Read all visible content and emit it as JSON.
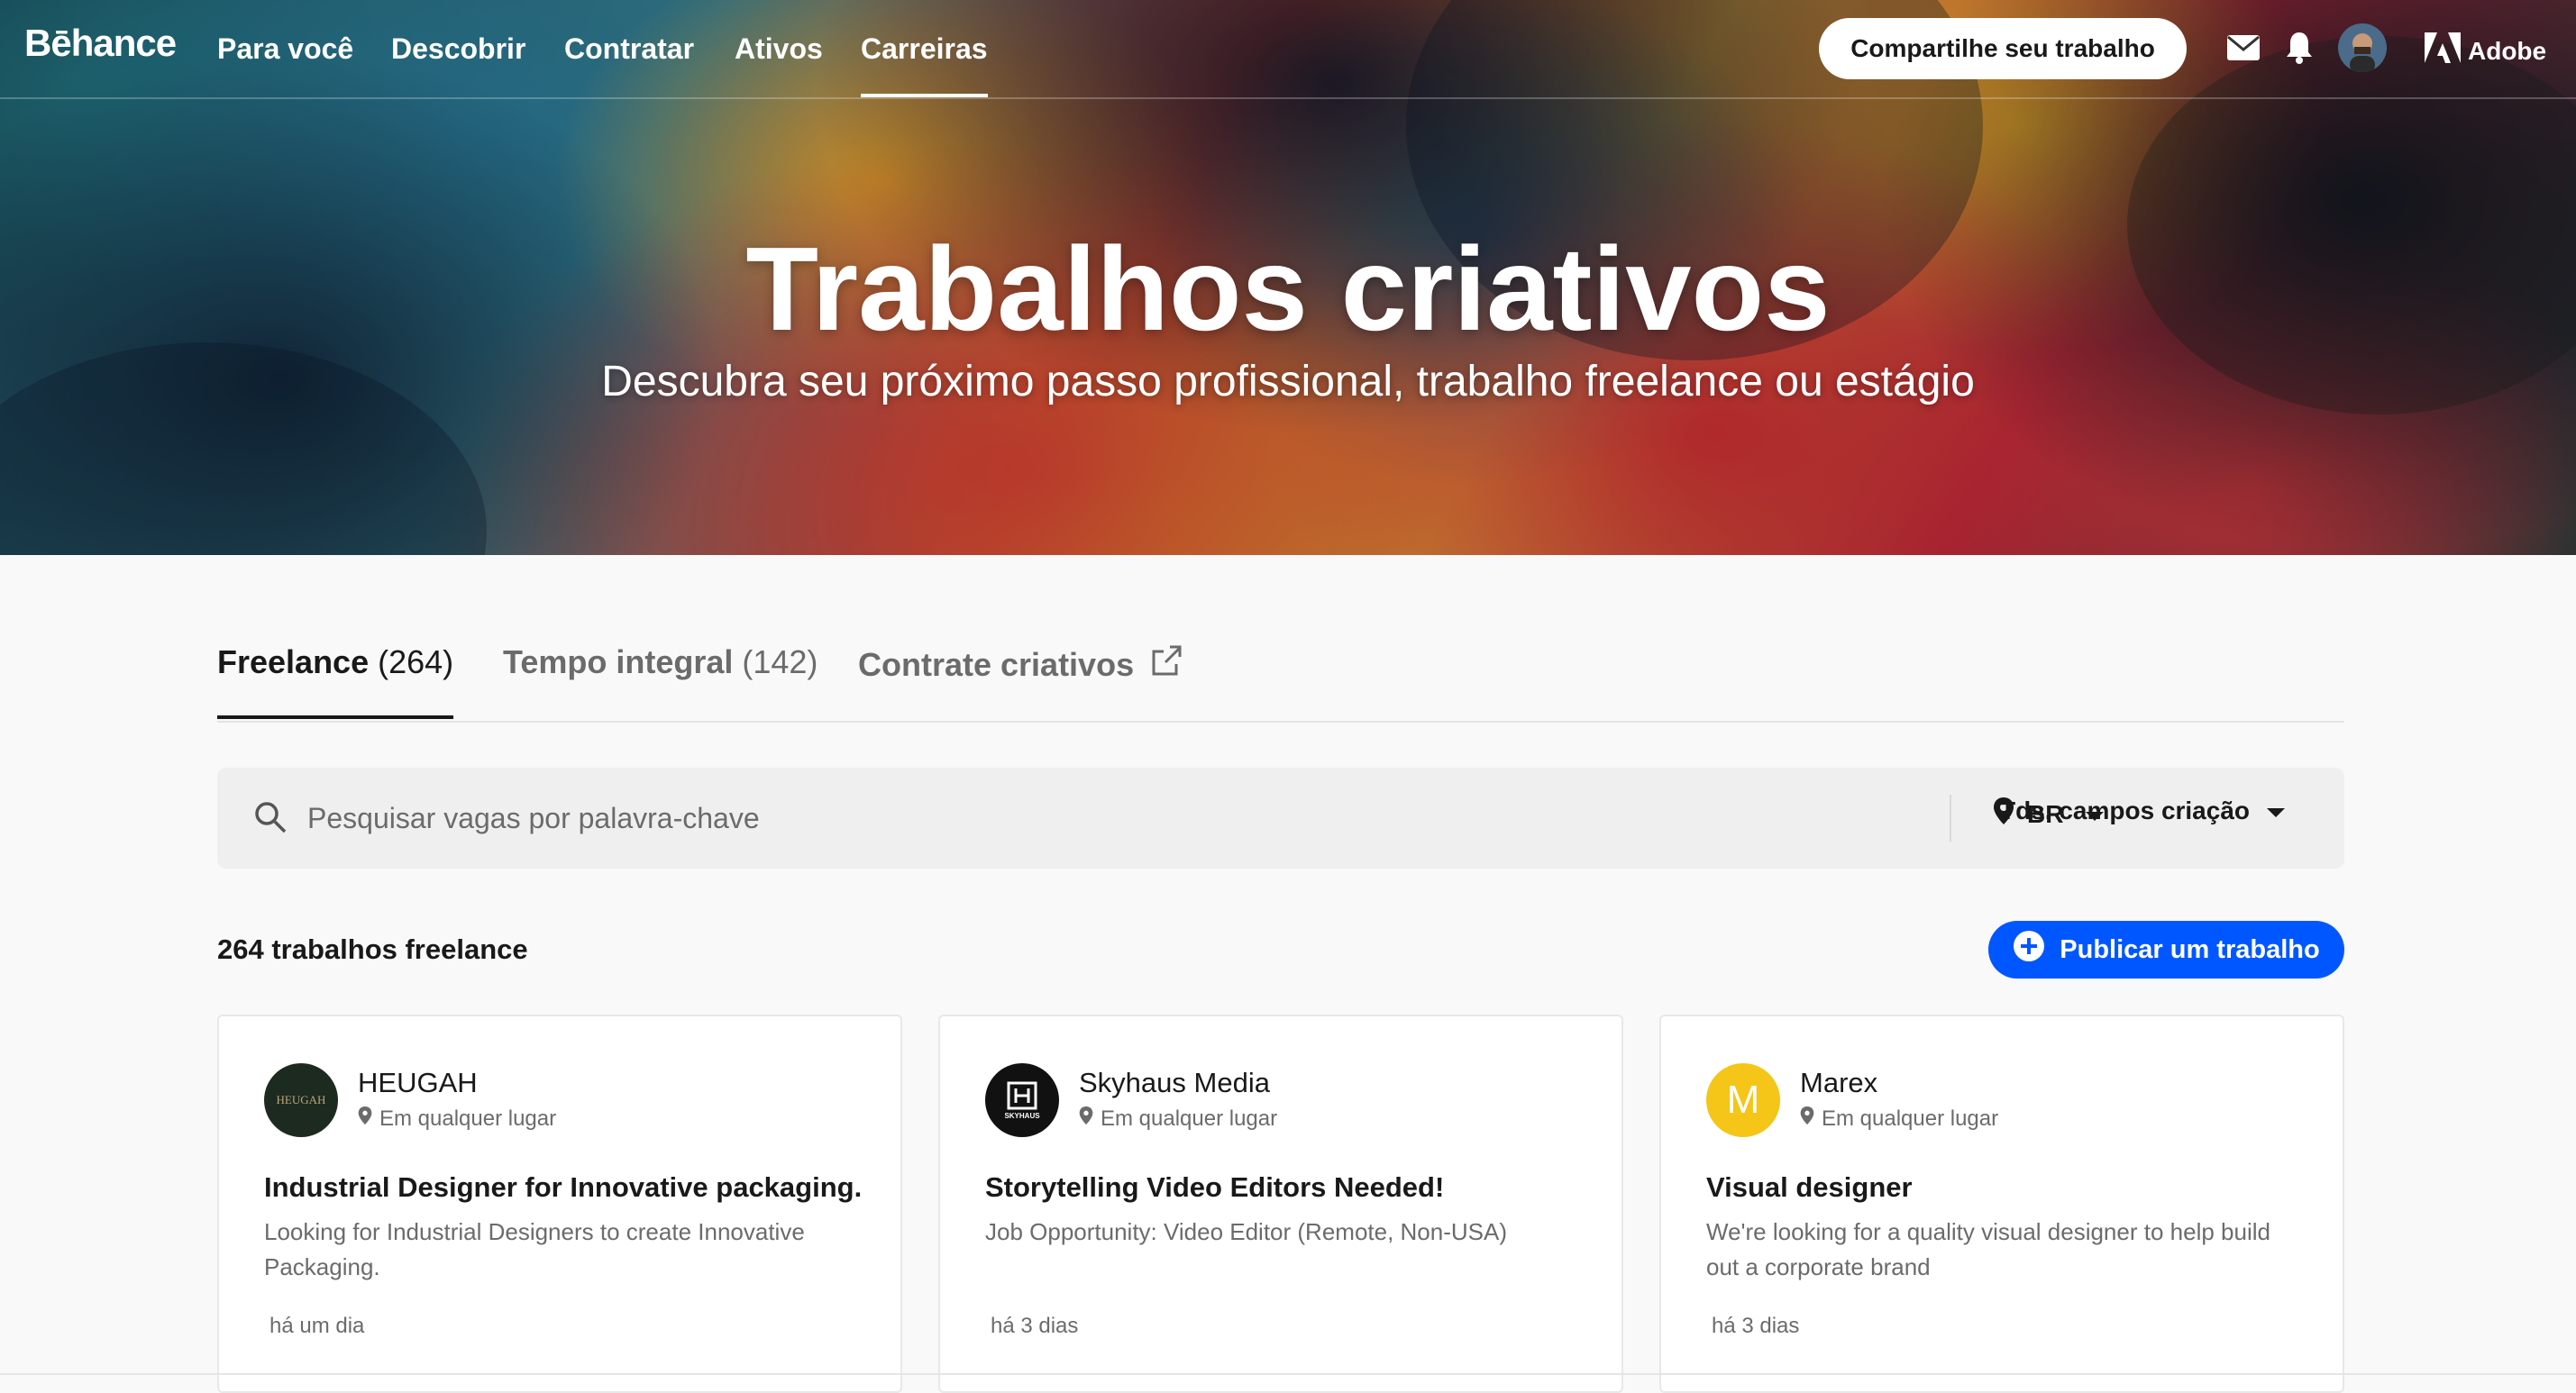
{
  "nav": {
    "logo": "Bēhance",
    "links": [
      {
        "label": "Para você"
      },
      {
        "label": "Descobrir"
      },
      {
        "label": "Contratar"
      },
      {
        "label": "Ativos"
      },
      {
        "label": "Carreiras",
        "active": true
      }
    ],
    "share_label": "Compartilhe seu trabalho",
    "icons": [
      "mail-icon",
      "bell-icon",
      "user-avatar",
      "adobe-logo-icon"
    ],
    "adobe_label": "Adobe"
  },
  "hero": {
    "title": "Trabalhos criativos",
    "subtitle": "Descubra seu próximo passo profissional, trabalho freelance ou estágio"
  },
  "tabs": [
    {
      "label": "Freelance",
      "count": "(264)",
      "active": true
    },
    {
      "label": "Tempo integral",
      "count": "(142)"
    },
    {
      "label": "Contrate criativos",
      "icon": "external-link-icon"
    }
  ],
  "search": {
    "placeholder": "Pesquisar vagas por palavra-chave",
    "location": "BR",
    "field": "Tds. campos criação"
  },
  "results": {
    "count_label": "264 trabalhos freelance",
    "publish_label": "Publicar um trabalho"
  },
  "cards": [
    {
      "company": "HEUGAH",
      "avatar_text": "HEUGAH",
      "location": "Em qualquer lugar",
      "title": "Industrial Designer for Innovative packaging.",
      "description": "Looking for Industrial Designers to create Innovative Packaging.",
      "posted": "há um dia"
    },
    {
      "company": "Skyhaus Media",
      "avatar_text": "SKYHAUS",
      "location": "Em qualquer lugar",
      "title": "Storytelling Video Editors Needed!",
      "description": "Job Opportunity: Video Editor (Remote, Non-USA)",
      "posted": "há 3 dias"
    },
    {
      "company": "Marex",
      "avatar_text": "M",
      "location": "Em qualquer lugar",
      "title": "Visual designer",
      "description": "We're looking for a quality visual designer to help build out a corporate brand",
      "posted": "há 3 dias"
    }
  ],
  "colors": {
    "accent": "#0057ff",
    "text": "#191919",
    "muted": "#6b6b6b",
    "marex_avatar": "#f5c518"
  }
}
